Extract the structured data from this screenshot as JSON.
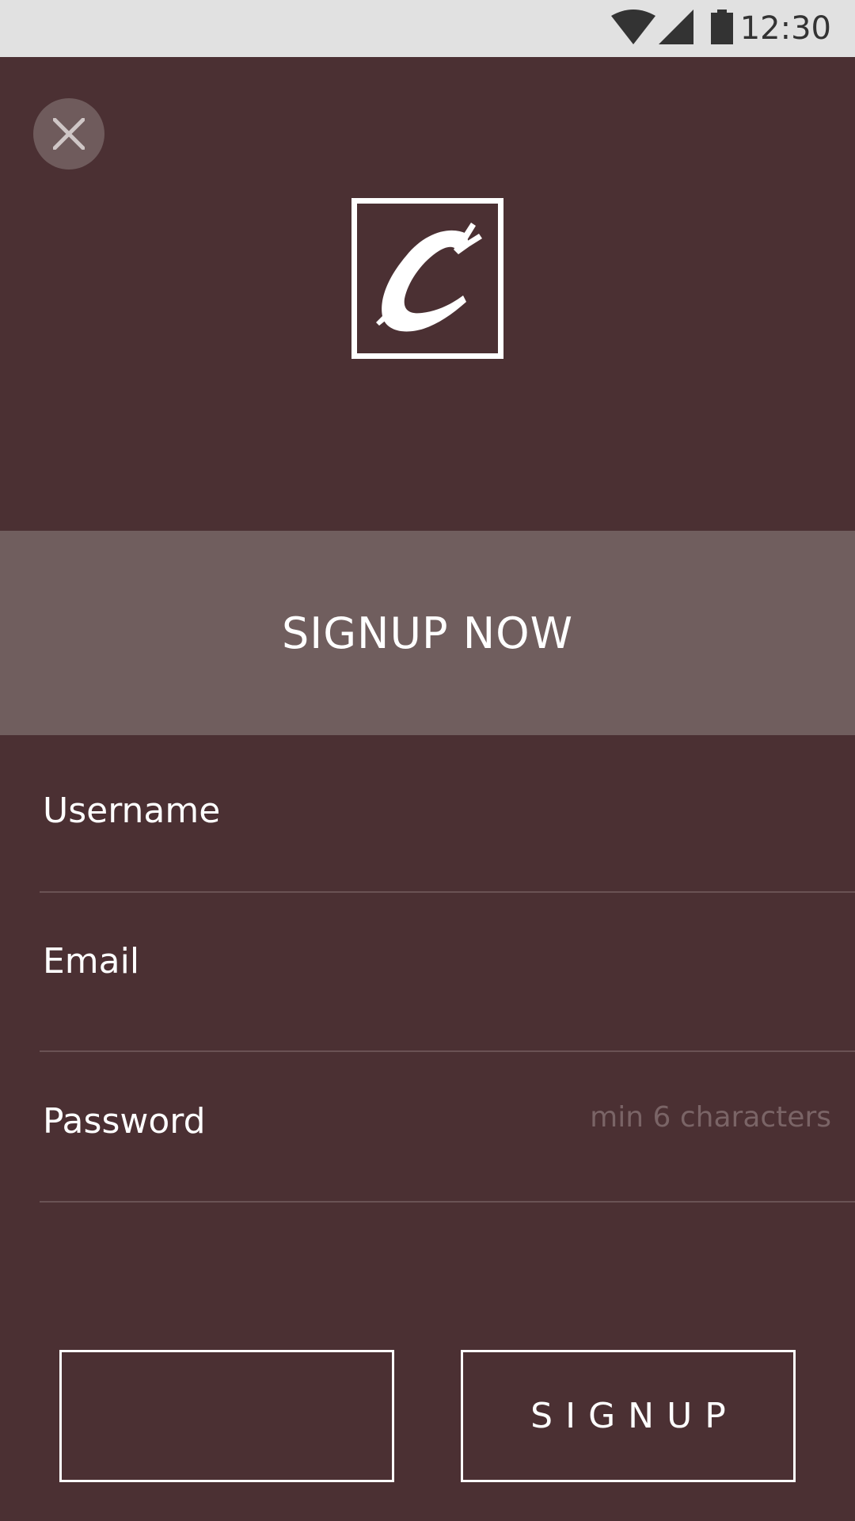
{
  "status_bar": {
    "time": "12:30",
    "icons": [
      "wifi-icon",
      "cell-signal-icon",
      "battery-icon"
    ]
  },
  "close_button": {
    "icon": "close-icon"
  },
  "logo": {
    "icon": "brush-letter-c-logo"
  },
  "banner": {
    "title": "SIGNUP NOW"
  },
  "form": {
    "username": {
      "label": "Username",
      "value": ""
    },
    "email": {
      "label": "Email",
      "value": ""
    },
    "password": {
      "label": "Password",
      "hint": "min 6 characters",
      "value": ""
    }
  },
  "buttons": {
    "left_label": "",
    "signup_label": "SIGNUP"
  },
  "colors": {
    "background": "#4b3033",
    "banner": "#705e5e",
    "status_bar": "#e1e1e1",
    "text": "#ffffff",
    "hint": "#7a6466"
  }
}
